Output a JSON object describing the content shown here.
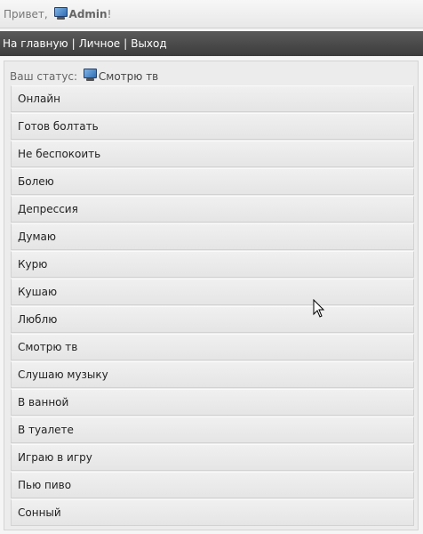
{
  "header": {
    "greeting": "Привет,",
    "username": "Admin",
    "exclaim": "!",
    "icon": "monitor-icon"
  },
  "nav": {
    "home": "На главную",
    "personal": "Личное",
    "logout": "Выход",
    "separator": "|"
  },
  "status": {
    "label": "Ваш статус:",
    "current": "Смотрю тв",
    "icon": "monitor-icon"
  },
  "statuses": [
    "Онлайн",
    "Готов болтать",
    "Не беспокоить",
    "Болею",
    "Депрессия",
    "Думаю",
    "Курю",
    "Кушаю",
    "Люблю",
    "Смотрю тв",
    "Слушаю музыку",
    "В ванной",
    "В туалете",
    "Играю в игру",
    "Пью пиво",
    "Сонный"
  ]
}
